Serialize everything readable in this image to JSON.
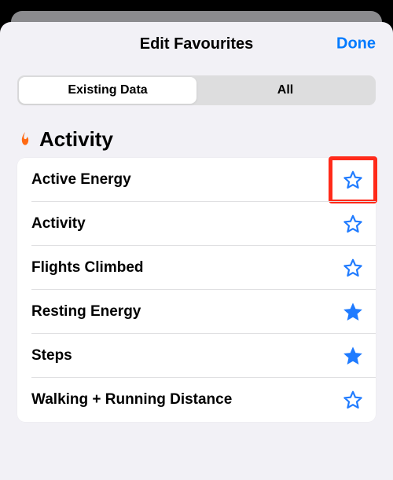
{
  "header": {
    "title": "Edit Favourites",
    "done_label": "Done"
  },
  "segmented": {
    "items": [
      {
        "label": "Existing Data",
        "selected": true
      },
      {
        "label": "All",
        "selected": false
      }
    ]
  },
  "section": {
    "title": "Activity",
    "accent_color": "#ff6a13"
  },
  "rows": [
    {
      "label": "Active Energy",
      "favourite": false,
      "highlighted": true
    },
    {
      "label": "Activity",
      "favourite": false,
      "highlighted": false
    },
    {
      "label": "Flights Climbed",
      "favourite": false,
      "highlighted": false
    },
    {
      "label": "Resting Energy",
      "favourite": true,
      "highlighted": false
    },
    {
      "label": "Steps",
      "favourite": true,
      "highlighted": false
    },
    {
      "label": "Walking + Running Distance",
      "favourite": false,
      "highlighted": false
    }
  ],
  "star_color": "#1f7bff"
}
